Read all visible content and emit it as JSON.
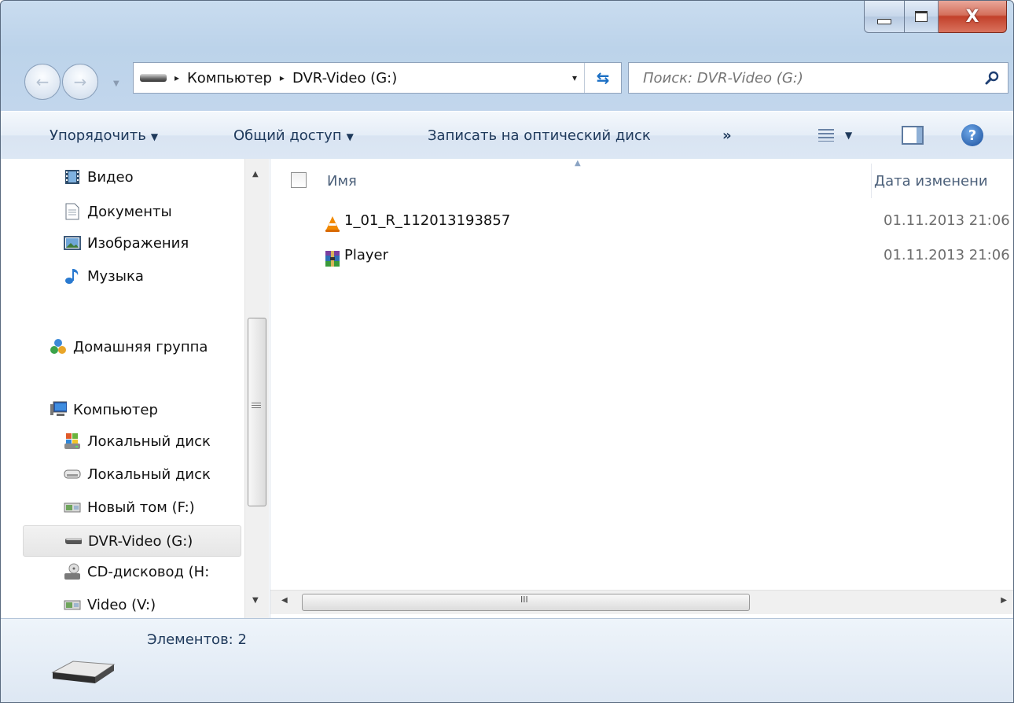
{
  "window": {
    "caption": {
      "minimize_icon": "minimize-icon",
      "maximize_icon": "maximize-icon",
      "close_icon": "close-icon",
      "close_glyph": "X"
    }
  },
  "navigation": {
    "back_icon": "back-arrow-icon",
    "forward_icon": "forward-arrow-icon"
  },
  "address_bar": {
    "breadcrumbs": [
      "Компьютер",
      "DVR-Video (G:)"
    ],
    "separator": "▸",
    "dropdown_glyph": "▾",
    "refresh_glyph": "⇆"
  },
  "search": {
    "placeholder": "Поиск: DVR-Video (G:)"
  },
  "command_bar": {
    "organize": "Упорядочить",
    "share": "Общий доступ",
    "burn": "Записать на оптический диск",
    "more": "»",
    "dropdown_glyph": "▼",
    "help_glyph": "?"
  },
  "nav_pane": {
    "libraries": [
      {
        "label": "Видео",
        "icon": "video-library-icon"
      },
      {
        "label": "Документы",
        "icon": "documents-library-icon"
      },
      {
        "label": "Изображения",
        "icon": "pictures-library-icon"
      },
      {
        "label": "Музыка",
        "icon": "music-library-icon"
      }
    ],
    "homegroup": {
      "label": "Домашняя группа",
      "icon": "homegroup-icon"
    },
    "computer": {
      "label": "Компьютер",
      "icon": "computer-icon"
    },
    "drives": [
      {
        "label": "Локальный диск",
        "icon": "system-drive-icon"
      },
      {
        "label": "Локальный диск",
        "icon": "hard-drive-icon"
      },
      {
        "label": "Новый том (F:)",
        "icon": "network-drive-icon"
      },
      {
        "label": "DVR-Video (G:)",
        "icon": "removable-drive-icon",
        "selected": true
      },
      {
        "label": "CD-дисковод (H:",
        "icon": "cd-drive-icon"
      },
      {
        "label": "Video (V:)",
        "icon": "network-drive-icon"
      }
    ]
  },
  "file_list": {
    "columns": {
      "name": "Имя",
      "date": "Дата изменени"
    },
    "rows": [
      {
        "name": "1_01_R_112013193857",
        "date": "01.11.2013 21:06",
        "icon": "vlc-icon"
      },
      {
        "name": "Player",
        "date": "01.11.2013 21:06",
        "icon": "winrar-archive-icon"
      }
    ],
    "hscroll_grip": "III"
  },
  "details_pane": {
    "count_text": "Элементов: 2",
    "icon": "removable-drive-icon"
  },
  "colors": {
    "frame": "#bcd3ea",
    "command_text": "#1e395b",
    "header_text": "#4c607a",
    "date_text": "#6d6d6d",
    "close_button": "#c2402a"
  }
}
